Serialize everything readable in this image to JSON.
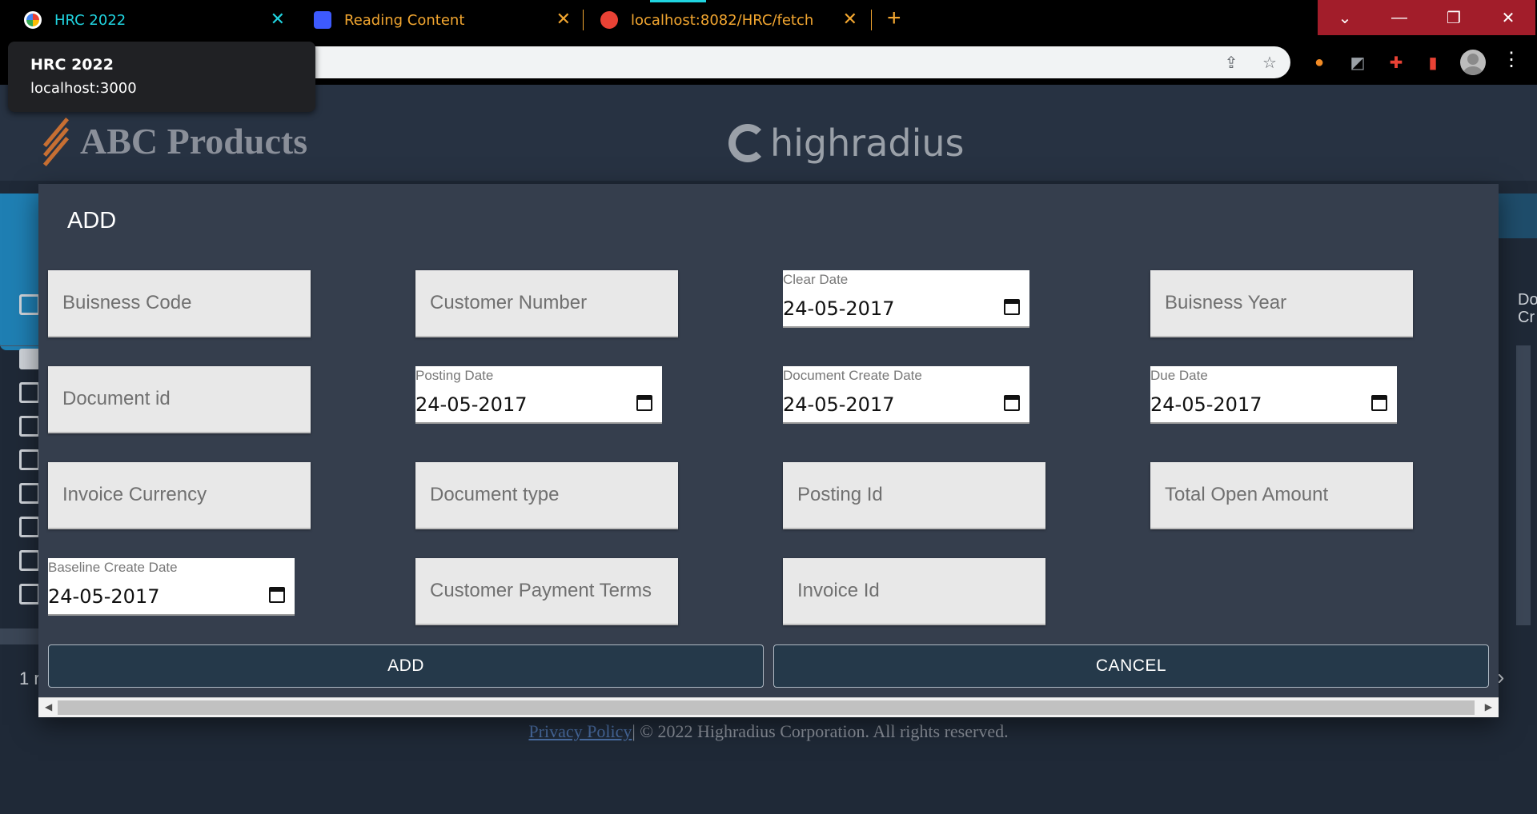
{
  "browser": {
    "tabs": [
      {
        "title": "HRC 2022",
        "icon": "hrc-favicon"
      },
      {
        "title": "Reading Content",
        "icon": "reading-favicon"
      },
      {
        "title": "localhost:8082/HRC/fetch",
        "icon": "globe-favicon"
      }
    ],
    "tooltip": {
      "title": "HRC 2022",
      "url": "localhost:3000"
    }
  },
  "header": {
    "brand": "ABC Products",
    "partner_logo": "highradius"
  },
  "footer": {
    "link": "Privacy Policy",
    "text": "| © 2022 Highradius Corporation. All rights reserved."
  },
  "modal": {
    "title": "ADD",
    "fields": {
      "business_code": "Buisness Code",
      "customer_number": "Customer Number",
      "business_year": "Buisness Year",
      "document_id": "Document id",
      "invoice_currency": "Invoice Currency",
      "document_type": "Document type",
      "posting_id": "Posting Id",
      "total_open_amount": "Total Open Amount",
      "customer_payment_terms": "Customer Payment Terms",
      "invoice_id": "Invoice Id"
    },
    "dates": {
      "clear_date": {
        "label": "Clear Date",
        "value": "24-05-2017"
      },
      "posting_date": {
        "label": "Posting Date",
        "value": "24-05-2017"
      },
      "document_create_date": {
        "label": "Document Create Date",
        "value": "24-05-2017"
      },
      "due_date": {
        "label": "Due Date",
        "value": "24-05-2017"
      },
      "baseline_create_date": {
        "label": "Baseline Create Date",
        "value": "24-05-2017"
      }
    },
    "buttons": {
      "add": "ADD",
      "cancel": "CANCEL"
    }
  },
  "background": {
    "left_label": "1 r",
    "header_label": "Do Cr"
  }
}
